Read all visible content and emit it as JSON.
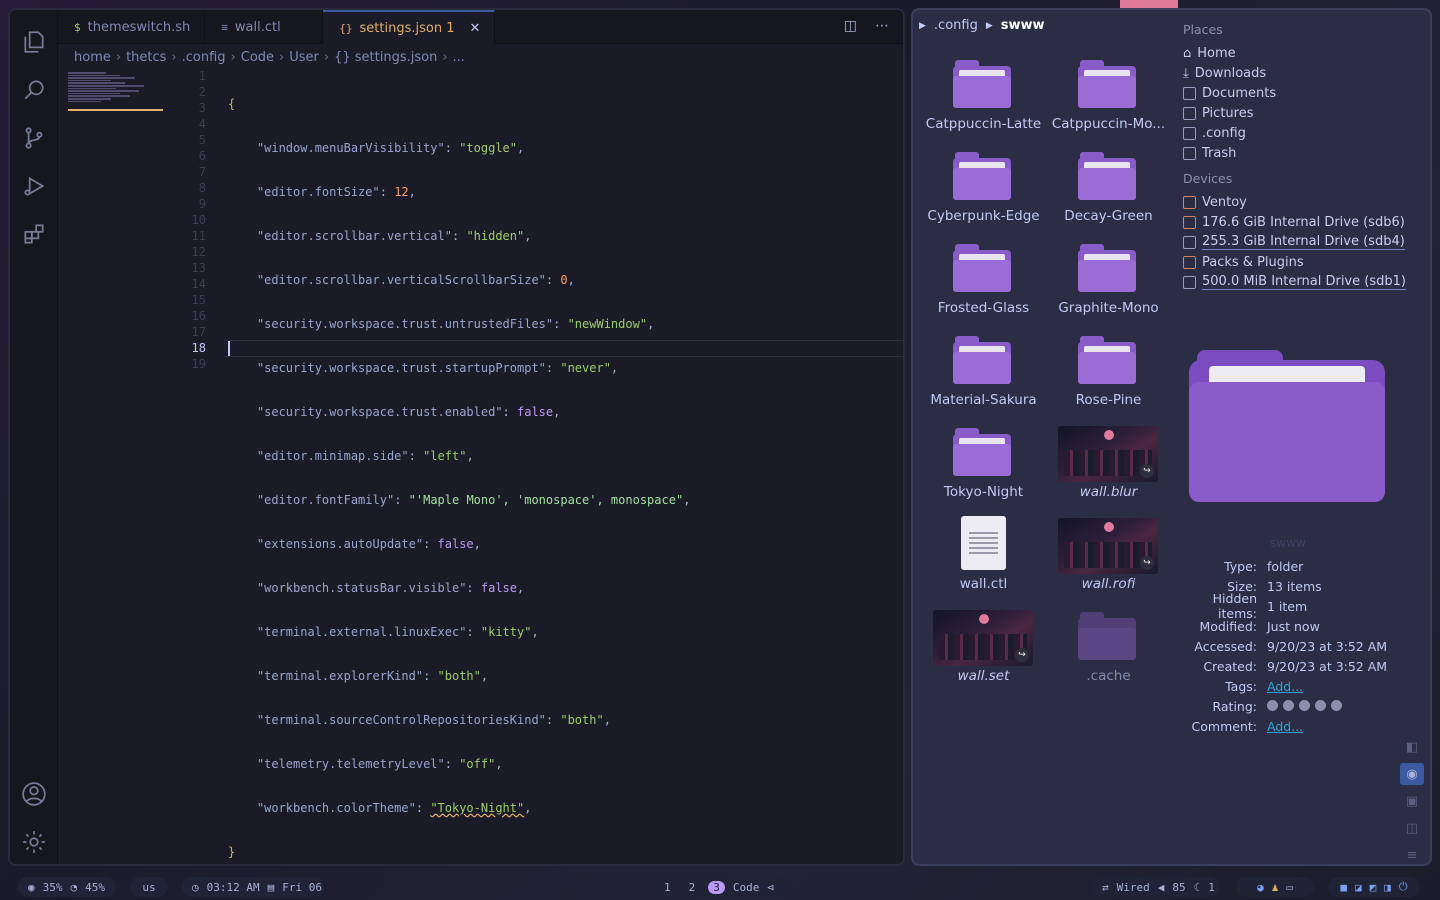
{
  "editor": {
    "tabs": [
      {
        "icon": "$",
        "label": "themeswitch.sh"
      },
      {
        "icon": "≡",
        "label": "wall.ctl"
      },
      {
        "icon": "{}",
        "label": "settings.json 1"
      }
    ],
    "breadcrumb": [
      "home",
      "thetcs",
      ".config",
      "Code",
      "User",
      "{} settings.json",
      "..."
    ],
    "line_numbers": [
      "1",
      "2",
      "3",
      "4",
      "5",
      "6",
      "7",
      "8",
      "9",
      "10",
      "11",
      "12",
      "13",
      "14",
      "15",
      "16",
      "17",
      "18",
      "19"
    ],
    "current_line": "18",
    "code": {
      "open": "{",
      "l2k": "\"window.menuBarVisibility\"",
      "l2v": "\"toggle\"",
      "l3k": "\"editor.fontSize\"",
      "l3v": "12",
      "l4k": "\"editor.scrollbar.vertical\"",
      "l4v": "\"hidden\"",
      "l5k": "\"editor.scrollbar.verticalScrollbarSize\"",
      "l5v": "0",
      "l6k": "\"security.workspace.trust.untrustedFiles\"",
      "l6v": "\"newWindow\"",
      "l7k": "\"security.workspace.trust.startupPrompt\"",
      "l7v": "\"never\"",
      "l8k": "\"security.workspace.trust.enabled\"",
      "l8v": "false",
      "l9k": "\"editor.minimap.side\"",
      "l9v": "\"left\"",
      "l10k": "\"editor.fontFamily\"",
      "l10v": "\"'Maple Mono', 'monospace', monospace\"",
      "l11k": "\"extensions.autoUpdate\"",
      "l11v": "false",
      "l12k": "\"workbench.statusBar.visible\"",
      "l12v": "false",
      "l13k": "\"terminal.external.linuxExec\"",
      "l13v": "\"kitty\"",
      "l14k": "\"terminal.explorerKind\"",
      "l14v": "\"both\"",
      "l15k": "\"terminal.sourceControlRepositoriesKind\"",
      "l15v": "\"both\"",
      "l16k": "\"telemetry.telemetryLevel\"",
      "l16v": "\"off\"",
      "l17k": "\"workbench.colorTheme\"",
      "l17v": "\"Tokyo-Night\"",
      "close": "}"
    }
  },
  "files": {
    "crumb": [
      ".config",
      "swww"
    ],
    "items": [
      {
        "label": "Catppuccin-Latte",
        "kind": "folder"
      },
      {
        "label": "Catppuccin-Mo...",
        "kind": "folder"
      },
      {
        "label": "Cyberpunk-Edge",
        "kind": "folder"
      },
      {
        "label": "Decay-Green",
        "kind": "folder"
      },
      {
        "label": "Frosted-Glass",
        "kind": "folder"
      },
      {
        "label": "Graphite-Mono",
        "kind": "folder"
      },
      {
        "label": "Material-Sakura",
        "kind": "folder"
      },
      {
        "label": "Rose-Pine",
        "kind": "folder"
      },
      {
        "label": "Tokyo-Night",
        "kind": "folder"
      },
      {
        "label": "wall.blur",
        "kind": "image-link"
      },
      {
        "label": "wall.ctl",
        "kind": "text"
      },
      {
        "label": "wall.rofi",
        "kind": "image-link"
      },
      {
        "label": "wall.set",
        "kind": "image-link"
      },
      {
        "label": ".cache",
        "kind": "folder-hidden"
      }
    ],
    "places_heading": "Places",
    "places": [
      "Home",
      "Downloads",
      "Documents",
      "Pictures",
      ".config",
      "Trash"
    ],
    "devices_heading": "Devices",
    "devices": [
      "Ventoy",
      "176.6 GiB Internal Drive (sdb6)",
      "255.3 GiB Internal Drive (sdb4)",
      "Packs & Plugins",
      "500.0 MiB Internal Drive (sdb1)"
    ],
    "info": {
      "name": "swww",
      "type_label": "Type:",
      "type": "folder",
      "size_label": "Size:",
      "size": "13 items",
      "hidden_label": "Hidden items:",
      "hidden": "1 item",
      "modified_label": "Modified:",
      "modified": "Just now",
      "accessed_label": "Accessed:",
      "accessed": "9/20/23 at 3:52 AM",
      "created_label": "Created:",
      "created": "9/20/23 at 3:52 AM",
      "tags_label": "Tags:",
      "tags": "Add...",
      "rating_label": "Rating:",
      "rating": 0,
      "comment_label": "Comment:",
      "comment": "Add..."
    }
  },
  "statusbar": {
    "cpu": "35%",
    "mem": "45%",
    "layout": "us",
    "time": "03:12 AM",
    "date": "Fri 06",
    "workspaces": [
      "1",
      "2",
      "3"
    ],
    "active_workspace": "3",
    "window": "Code",
    "network": "Wired",
    "volume": "85",
    "brightness": "1"
  },
  "colors": {
    "accent": "#7aa2f7",
    "folder": "#8a5cc9",
    "active_tab": "#e0af68"
  }
}
